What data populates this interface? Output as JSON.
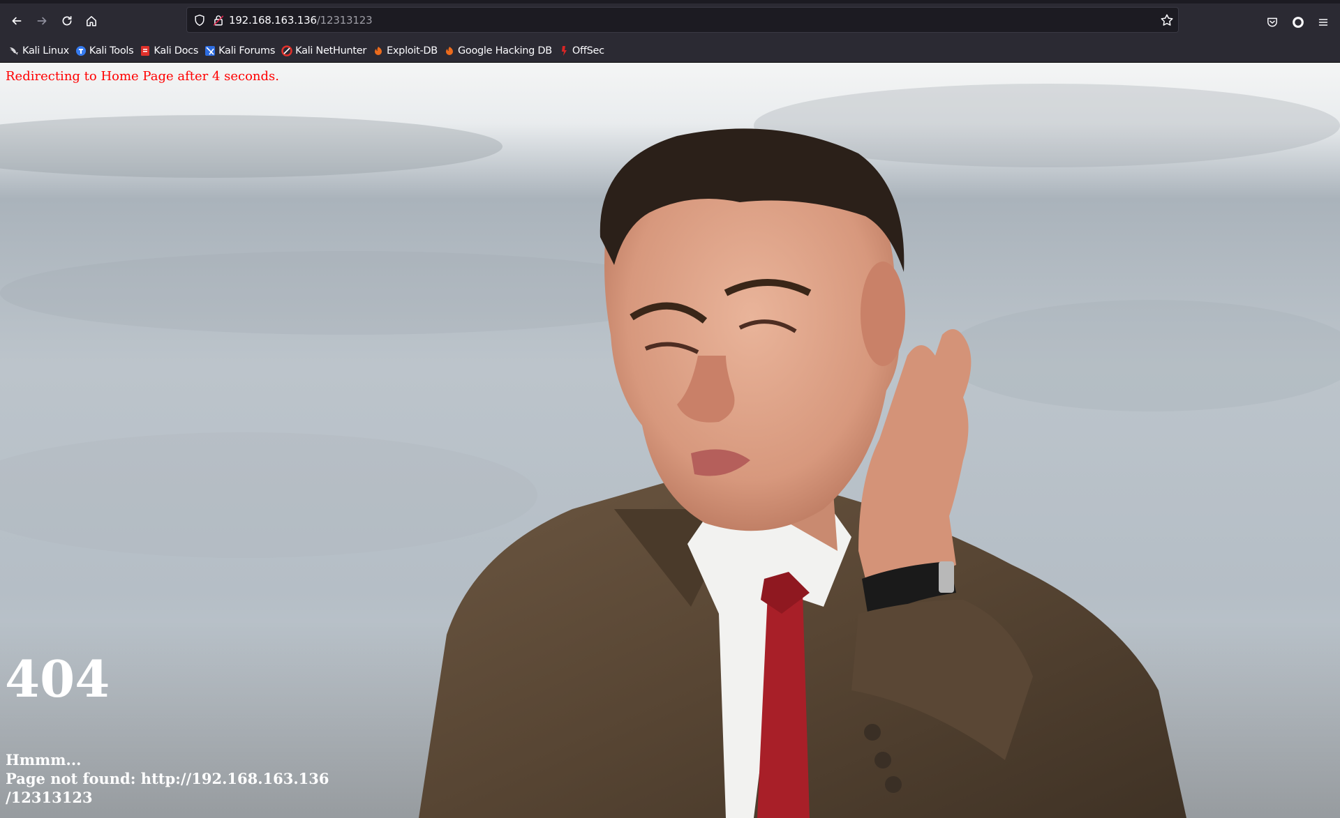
{
  "browser": {
    "url_host": "192.168.163.136",
    "url_path": "/12313123"
  },
  "bookmarks": [
    {
      "label": "Kali Linux",
      "icon": "kali-dragon-icon"
    },
    {
      "label": "Kali Tools",
      "icon": "kali-tools-icon"
    },
    {
      "label": "Kali Docs",
      "icon": "kali-docs-icon"
    },
    {
      "label": "Kali Forums",
      "icon": "kali-forums-icon"
    },
    {
      "label": "Kali NetHunter",
      "icon": "kali-nethunter-icon"
    },
    {
      "label": "Exploit-DB",
      "icon": "exploit-db-icon"
    },
    {
      "label": "Google Hacking DB",
      "icon": "google-hacking-db-icon"
    },
    {
      "label": "OffSec",
      "icon": "offsec-icon"
    }
  ],
  "page": {
    "redirect_notice": "Redirecting to Home Page after 4 seconds.",
    "error_code": "404",
    "line_1": "Hmmm...",
    "line_2": "Page not found: http://192.168.163.136",
    "line_3": "/12313123"
  },
  "colors": {
    "redirect_text": "#ff0000",
    "message_text": "#ffffff",
    "toolbar_bg": "#2b2a33"
  }
}
